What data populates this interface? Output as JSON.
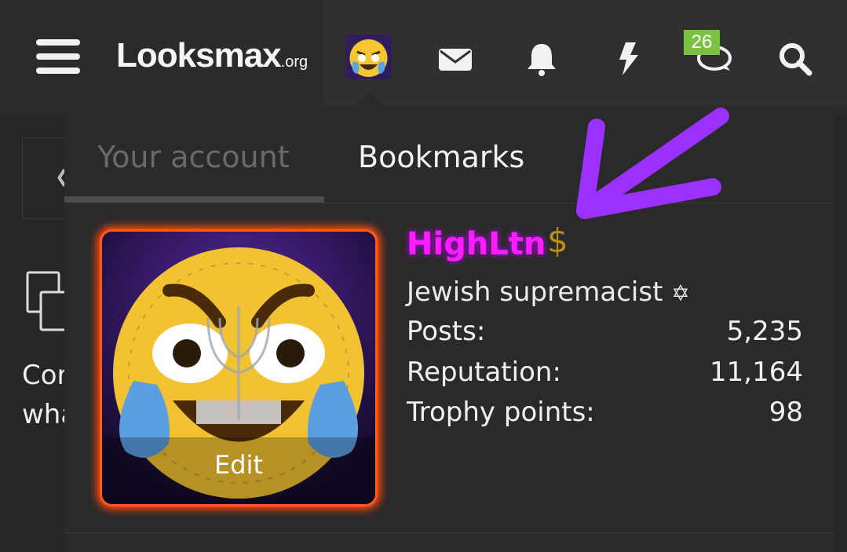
{
  "header": {
    "logo_main": "Looksmax",
    "logo_suffix": ".org",
    "conversations_badge": "26",
    "icons": [
      "menu-icon",
      "envelope-icon",
      "bell-icon",
      "lightning-icon",
      "chat-icon",
      "search-icon"
    ]
  },
  "menu": {
    "tabs": [
      {
        "label": "Your account",
        "active": true
      },
      {
        "label": "Bookmarks",
        "active": false
      }
    ]
  },
  "profile": {
    "avatar_action": "Edit",
    "username": "HighLtn",
    "badge_symbol": "$",
    "user_title": "Jewish supremacist",
    "title_symbol": "✡",
    "stats": [
      {
        "label": "Posts:",
        "value": "5,235"
      },
      {
        "label": "Reputation:",
        "value": "11,164"
      },
      {
        "label": "Trophy points:",
        "value": "98"
      }
    ]
  },
  "background_page": {
    "text_line_1": "Cor",
    "text_line_2": "wha"
  },
  "colors": {
    "username": "#ff1dff",
    "avatar_border": "#ff5a1f",
    "annotation_arrow": "#9b30ff",
    "badge": "#7cc242"
  }
}
